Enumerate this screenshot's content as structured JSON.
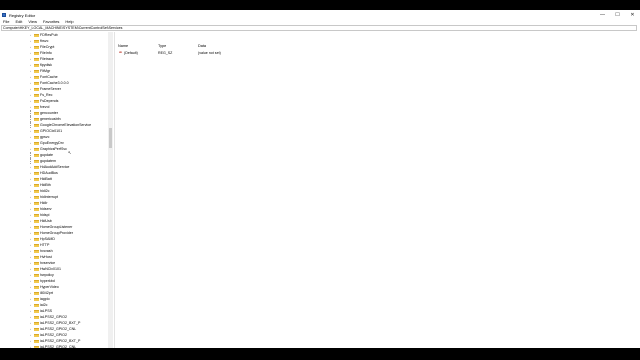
{
  "window": {
    "title": "Registry Editor",
    "controls": {
      "minimize": "—",
      "maximize": "☐",
      "close": "✕"
    }
  },
  "menu": [
    "File",
    "Edit",
    "View",
    "Favorites",
    "Help"
  ],
  "address": "Computer\\HKEY_LOCAL_MACHINE\\SYSTEM\\CurrentControlSet\\Services",
  "tree": {
    "items": [
      {
        "label": "FDResPub",
        "expandable": true
      },
      {
        "label": "fhsvc",
        "expandable": true
      },
      {
        "label": "FileCrypt",
        "expandable": true
      },
      {
        "label": "FileInfo",
        "expandable": true
      },
      {
        "label": "Filetrace",
        "expandable": true
      },
      {
        "label": "flpydisk",
        "expandable": true
      },
      {
        "label": "FltMgr",
        "expandable": true
      },
      {
        "label": "FontCache",
        "expandable": true
      },
      {
        "label": "FontCache3.0.0.0",
        "expandable": true
      },
      {
        "label": "FrameServer",
        "expandable": true
      },
      {
        "label": "Fs_Rec",
        "expandable": true
      },
      {
        "label": "FsDepends",
        "expandable": true
      },
      {
        "label": "fvevol",
        "expandable": true
      },
      {
        "label": "gencounter",
        "expandable": false
      },
      {
        "label": "genericusbfn",
        "expandable": false
      },
      {
        "label": "GoogleChromeElevationService",
        "expandable": false
      },
      {
        "label": "GPIOClx0101",
        "expandable": true
      },
      {
        "label": "gpsvc",
        "expandable": true
      },
      {
        "label": "GpuEnergyDrv",
        "expandable": true
      },
      {
        "label": "GraphicsPerfSvc",
        "expandable": true
      },
      {
        "label": "gupdate",
        "expandable": false
      },
      {
        "label": "gupdatem",
        "expandable": false
      },
      {
        "label": "HdAudAddService",
        "expandable": true
      },
      {
        "label": "HDAudBus",
        "expandable": true
      },
      {
        "label": "HidBatt",
        "expandable": true
      },
      {
        "label": "HidBth",
        "expandable": true
      },
      {
        "label": "hidi2c",
        "expandable": true
      },
      {
        "label": "hidinterrupt",
        "expandable": true
      },
      {
        "label": "HidIr",
        "expandable": true
      },
      {
        "label": "hidserv",
        "expandable": true
      },
      {
        "label": "hidspi",
        "expandable": true
      },
      {
        "label": "HidUsb",
        "expandable": true
      },
      {
        "label": "HomeGroupListener",
        "expandable": true
      },
      {
        "label": "HomeGroupProvider",
        "expandable": true
      },
      {
        "label": "HpSAMD",
        "expandable": true
      },
      {
        "label": "HTTP",
        "expandable": true
      },
      {
        "label": "hvcrash",
        "expandable": true
      },
      {
        "label": "HvHost",
        "expandable": true
      },
      {
        "label": "hvservice",
        "expandable": true
      },
      {
        "label": "HwNClx0101",
        "expandable": true
      },
      {
        "label": "hwpolicy",
        "expandable": true
      },
      {
        "label": "hyperkbd",
        "expandable": true
      },
      {
        "label": "HyperVideo",
        "expandable": true
      },
      {
        "label": "i8042prt",
        "expandable": true
      },
      {
        "label": "iagpio",
        "expandable": true
      },
      {
        "label": "iai2c",
        "expandable": true
      },
      {
        "label": "iaLPSS",
        "expandable": true
      },
      {
        "label": "iaLPSS2_GPIO2",
        "expandable": true
      },
      {
        "label": "iaLPSS2_GPIO2_BXT_P",
        "expandable": true
      },
      {
        "label": "iaLPSS2_GPIO2_CNL",
        "expandable": true
      },
      {
        "label": "iaLPSS2_GPIO2",
        "expandable": true
      },
      {
        "label": "iaLPSS2_GPIO2_BXT_P",
        "expandable": true
      },
      {
        "label": "iaLPSS2_GPIO2_CNL",
        "expandable": true
      }
    ]
  },
  "values_list": {
    "columns": [
      "Name",
      "Type",
      "Data"
    ],
    "rows": [
      {
        "icon": "ab",
        "name": "(Default)",
        "type": "REG_SZ",
        "data": "(value not set)"
      }
    ]
  }
}
